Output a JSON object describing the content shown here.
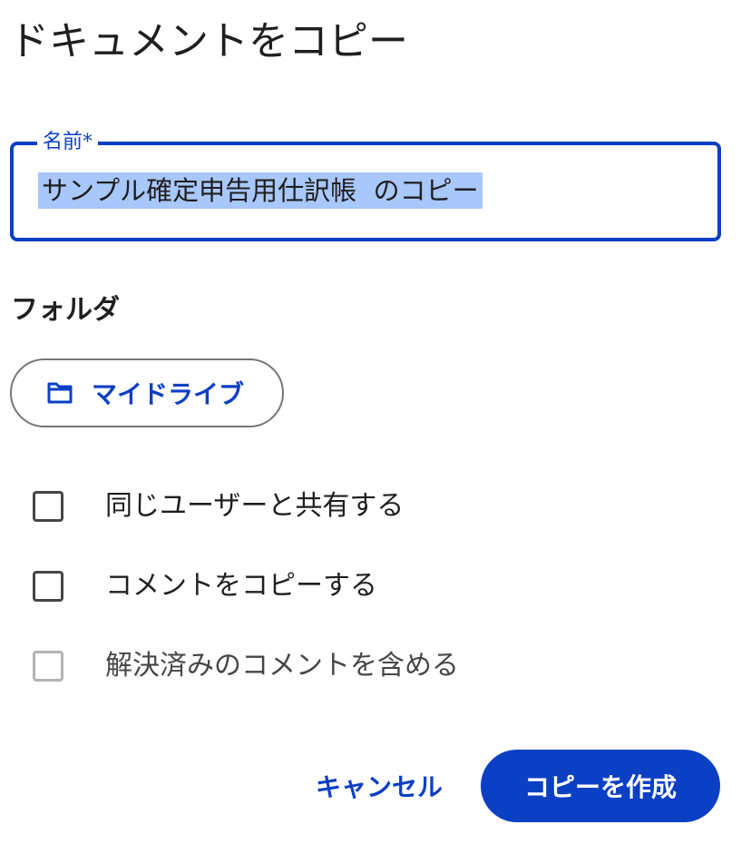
{
  "dialog": {
    "title": "ドキュメントをコピー"
  },
  "name_field": {
    "label": "名前*",
    "value": "サンプル確定申告用仕訳帳  のコピー"
  },
  "folder": {
    "heading": "フォルダ",
    "chip_label": "マイドライブ",
    "icon": "folder-icon"
  },
  "options": [
    {
      "label": "同じユーザーと共有する",
      "checked": false,
      "disabled": false
    },
    {
      "label": "コメントをコピーする",
      "checked": false,
      "disabled": false
    },
    {
      "label": "解決済みのコメントを含める",
      "checked": false,
      "disabled": true
    }
  ],
  "actions": {
    "cancel_label": "キャンセル",
    "create_label": "コピーを作成"
  },
  "colors": {
    "accent": "#0b3fc4",
    "selection": "#a8c7fa",
    "text": "#1f1f1f"
  }
}
